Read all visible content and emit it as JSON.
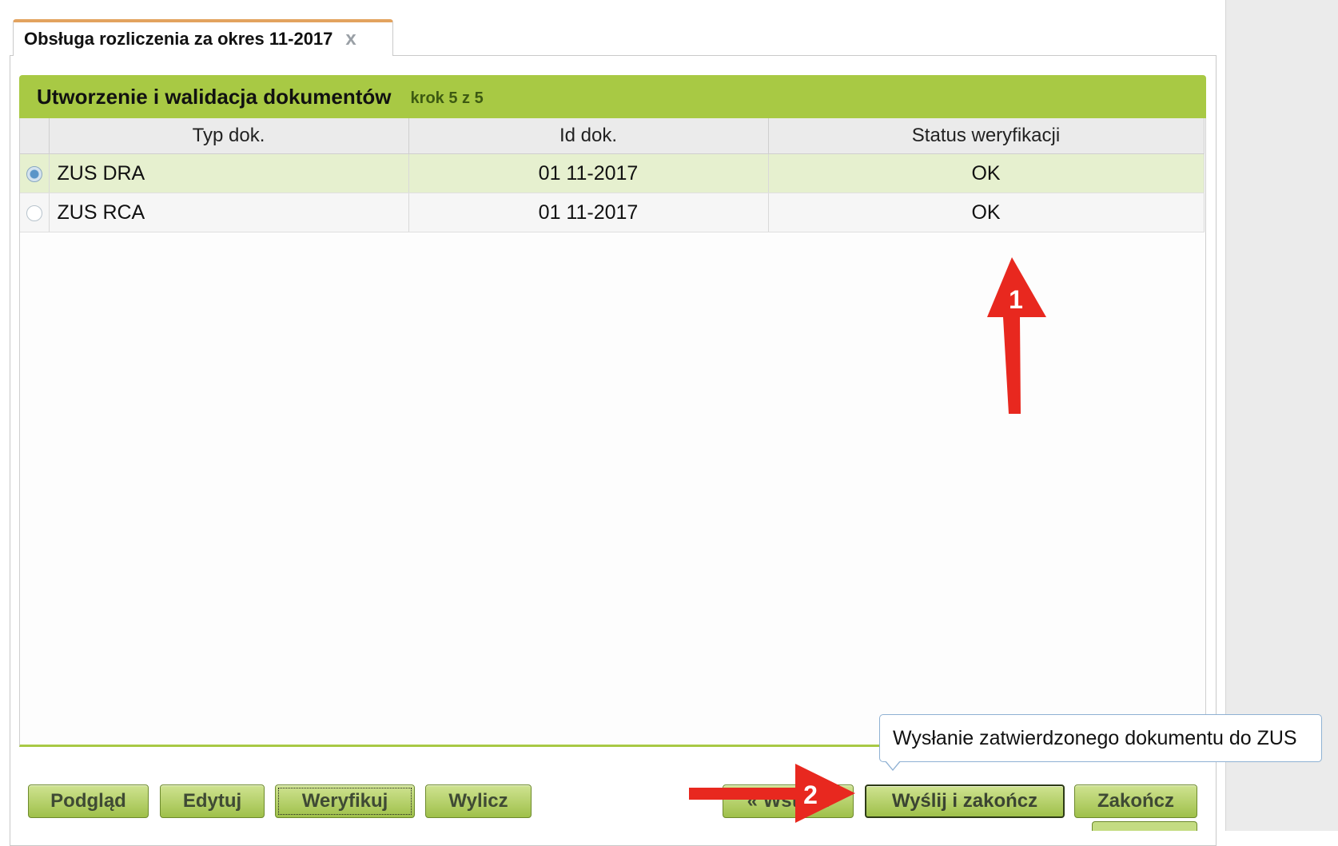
{
  "tab": {
    "title": "Obsługa rozliczenia za okres 11-2017",
    "close_glyph": "x"
  },
  "header": {
    "title": "Utworzenie i walidacja dokumentów",
    "step": "krok 5 z 5"
  },
  "grid": {
    "columns": [
      "Typ dok.",
      "Id dok.",
      "Status weryfikacji"
    ],
    "rows": [
      {
        "type": "ZUS DRA",
        "id": "01 11-2017",
        "status": "OK",
        "selected": true
      },
      {
        "type": "ZUS RCA",
        "id": "01 11-2017",
        "status": "OK",
        "selected": false
      }
    ]
  },
  "buttons": {
    "preview": "Podgląd",
    "edit": "Edytuj",
    "verify": "Weryfikuj",
    "calculate": "Wylicz",
    "back": "« Wstecz",
    "send_finish": "Wyślij i zakończ",
    "finish": "Zakończ"
  },
  "tooltip": {
    "text": "Wysłanie zatwierdzonego dokumentu do ZUS"
  },
  "annotations": {
    "marker_1": "1",
    "marker_2": "2",
    "arrow_color": "#e8281f"
  },
  "colors": {
    "accent_green": "#a8c944",
    "tab_top": "#e3a35f",
    "selected_row": "#e6f0cf"
  }
}
